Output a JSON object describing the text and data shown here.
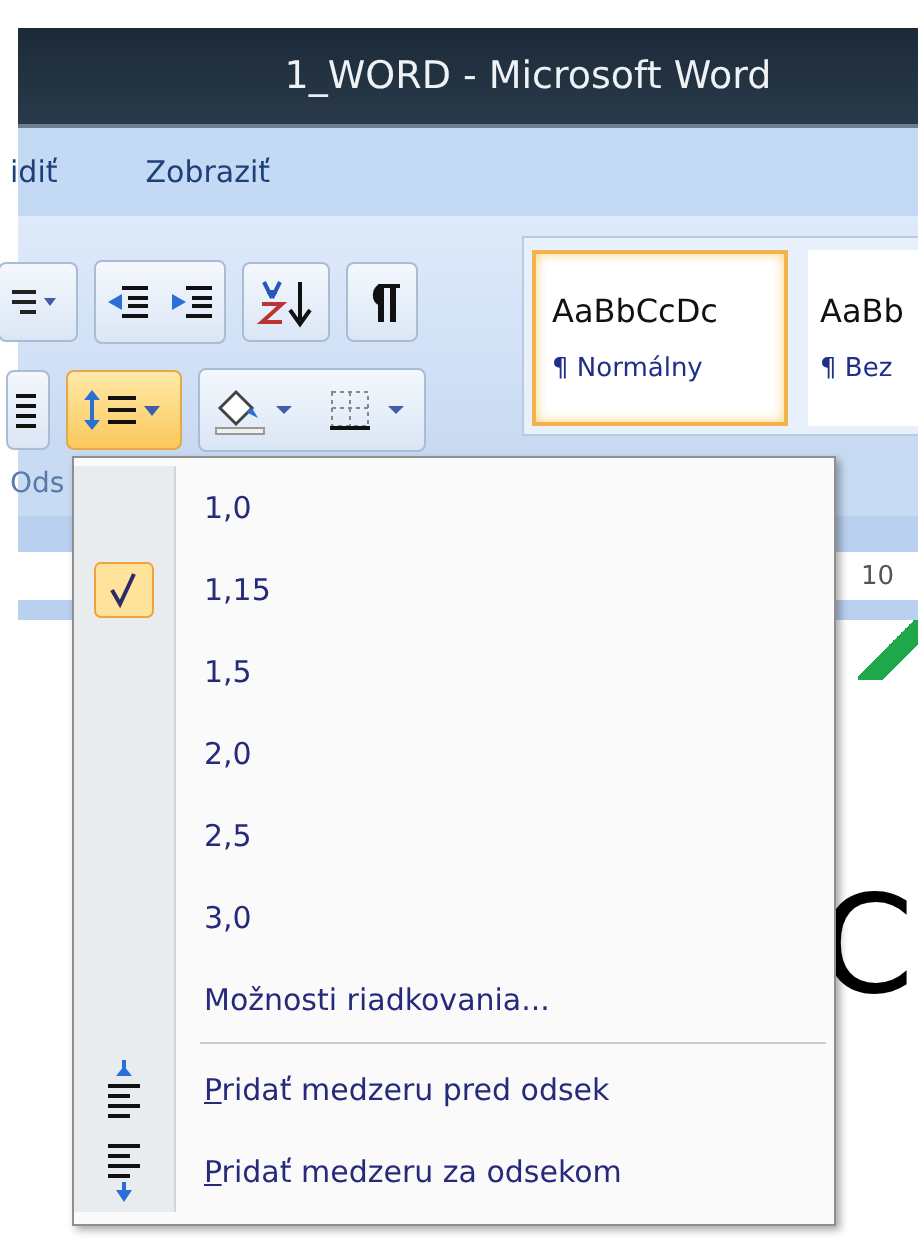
{
  "window": {
    "title": "1_WORD - Microsoft Word"
  },
  "tabs": [
    {
      "label": "idiť",
      "selected": false
    },
    {
      "label": "Zobraziť",
      "selected": false
    }
  ],
  "ribbon": {
    "line_spacing_button": {
      "active": true
    },
    "group_label": "Ods",
    "styles": [
      {
        "sample": "AaBbCcDc",
        "name": "¶ Normálny",
        "selected": true
      },
      {
        "sample": "AaBb",
        "name": "¶ Bez",
        "selected": false
      }
    ]
  },
  "ruler": {
    "mark": "10"
  },
  "document": {
    "fragments": [
      "C"
    ]
  },
  "menu": {
    "items": [
      {
        "kind": "option",
        "label": "1,0",
        "checked": false
      },
      {
        "kind": "option",
        "label": "1,15",
        "checked": true
      },
      {
        "kind": "option",
        "label": "1,5",
        "checked": false
      },
      {
        "kind": "option",
        "label": "2,0",
        "checked": false
      },
      {
        "kind": "option",
        "label": "2,5",
        "checked": false
      },
      {
        "kind": "option",
        "label": "3,0",
        "checked": false
      },
      {
        "kind": "command",
        "label": "Možnosti riadkovania..."
      },
      {
        "kind": "separator"
      },
      {
        "kind": "space-before",
        "label": "Pridať medzeru pred odsek",
        "accesskey": true
      },
      {
        "kind": "space-after",
        "label": "Pridať medzeru za odsekom",
        "accesskey": true
      }
    ]
  }
}
